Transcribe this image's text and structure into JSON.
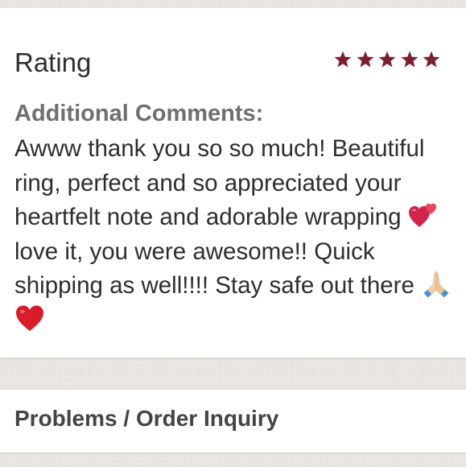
{
  "review": {
    "rating_label": "Rating",
    "rating_value": 5,
    "rating_max": 5,
    "star_color": "#7c1e2f",
    "comments_heading": "Additional Comments:",
    "comments_text_part1": "Awww thank you so so much! Beautiful ring, perfect and so appreciated your heartfelt note and adorable wrapping",
    "comments_text_part2": " love it, you were awesome!! Quick shipping as well!!!! Stay safe out there",
    "comments_emojis": [
      "two-hearts-emoji",
      "folded-hands-emoji",
      "red-heart-emoji"
    ]
  },
  "problems_section": {
    "title": "Problems / Order Inquiry"
  }
}
